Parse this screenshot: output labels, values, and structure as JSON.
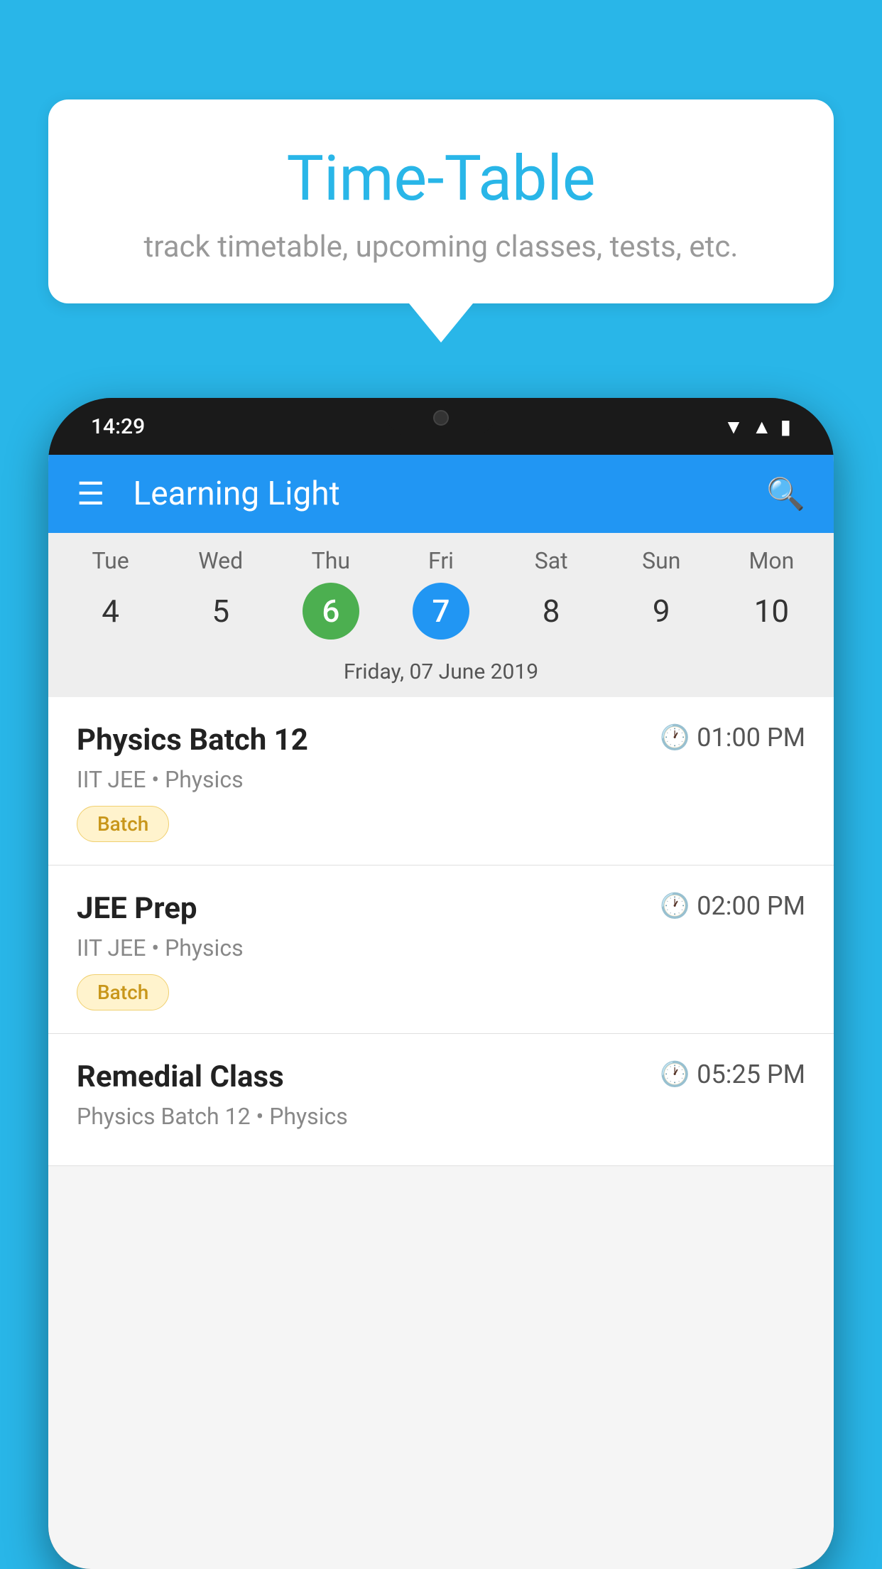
{
  "background_color": "#29b6e8",
  "speech_bubble": {
    "title": "Time-Table",
    "subtitle": "track timetable, upcoming classes, tests, etc."
  },
  "phone": {
    "status_bar": {
      "time": "14:29",
      "wifi": "▾",
      "signal": "▲",
      "battery": "▮"
    },
    "app_bar": {
      "title": "Learning Light",
      "hamburger_label": "Menu",
      "search_label": "Search"
    },
    "calendar": {
      "days": [
        {
          "abbr": "Tue",
          "num": "4"
        },
        {
          "abbr": "Wed",
          "num": "5"
        },
        {
          "abbr": "Thu",
          "num": "6",
          "state": "today"
        },
        {
          "abbr": "Fri",
          "num": "7",
          "state": "selected"
        },
        {
          "abbr": "Sat",
          "num": "8"
        },
        {
          "abbr": "Sun",
          "num": "9"
        },
        {
          "abbr": "Mon",
          "num": "10"
        }
      ],
      "selected_date_label": "Friday, 07 June 2019"
    },
    "classes": [
      {
        "name": "Physics Batch 12",
        "time": "01:00 PM",
        "subtitle": "IIT JEE • Physics",
        "tag": "Batch"
      },
      {
        "name": "JEE Prep",
        "time": "02:00 PM",
        "subtitle": "IIT JEE • Physics",
        "tag": "Batch"
      },
      {
        "name": "Remedial Class",
        "time": "05:25 PM",
        "subtitle": "Physics Batch 12 • Physics",
        "tag": ""
      }
    ]
  }
}
